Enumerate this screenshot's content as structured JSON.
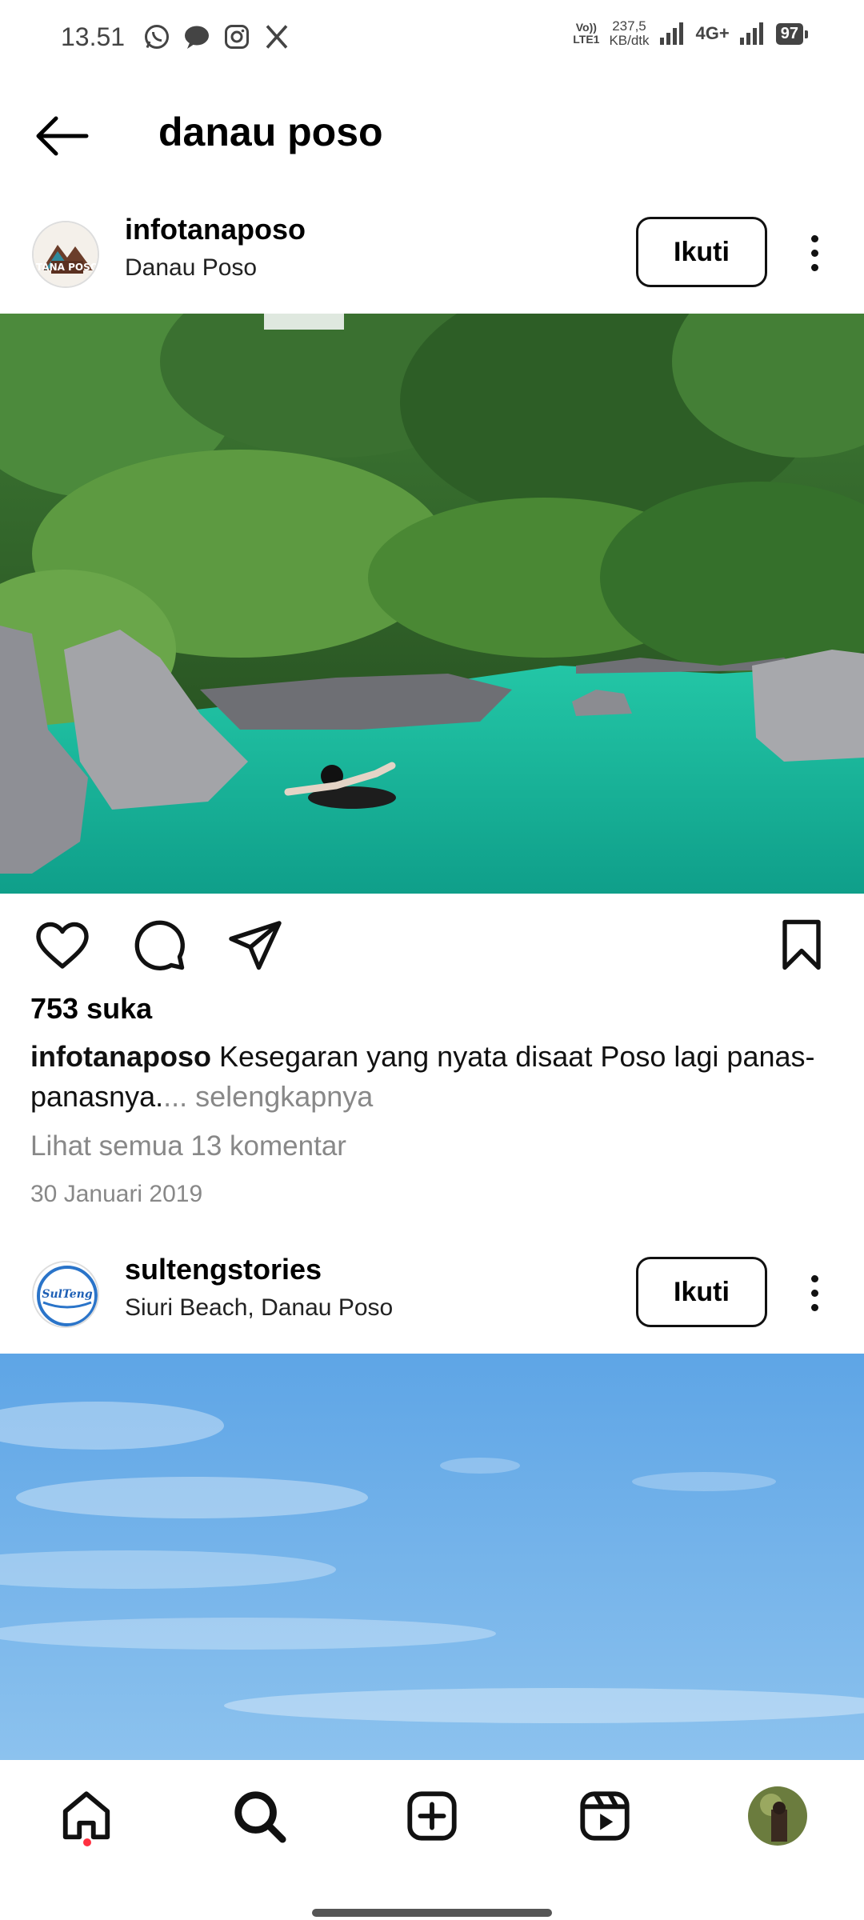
{
  "status_bar": {
    "time": "13.51",
    "app_icons": [
      "whatsapp-icon",
      "message-icon",
      "instagram-icon",
      "x-icon"
    ],
    "volte_top": "Vo))",
    "volte_bottom": "LTE1",
    "speed_top": "237,5",
    "speed_bottom": "KB/dtk",
    "network": "4G+",
    "battery": "97"
  },
  "header": {
    "title": "danau poso"
  },
  "posts": [
    {
      "username": "infotanaposo",
      "location": "Danau Poso",
      "follow_label": "Ikuti",
      "avatar_text": "TANA POSO",
      "likes": "753 suka",
      "caption_user": "infotanaposo",
      "caption_text": " Kesegaran yang nyata disaat Poso lagi panas-panasnya.",
      "caption_more": "... selengkapnya",
      "comments": "Lihat semua 13 komentar",
      "date": "30 Januari 2019"
    },
    {
      "username": "sultengstories",
      "location": "Siuri Beach, Danau Poso",
      "follow_label": "Ikuti",
      "avatar_text": "SulTeng"
    }
  ],
  "bottom_nav": [
    "home-icon",
    "search-icon",
    "create-icon",
    "reels-icon",
    "profile-avatar"
  ],
  "colors": {
    "water": "#1fc4a8",
    "forest": "#2f6b2a",
    "sky": "#7fb8e8",
    "notification_dot": "#ff3040"
  }
}
